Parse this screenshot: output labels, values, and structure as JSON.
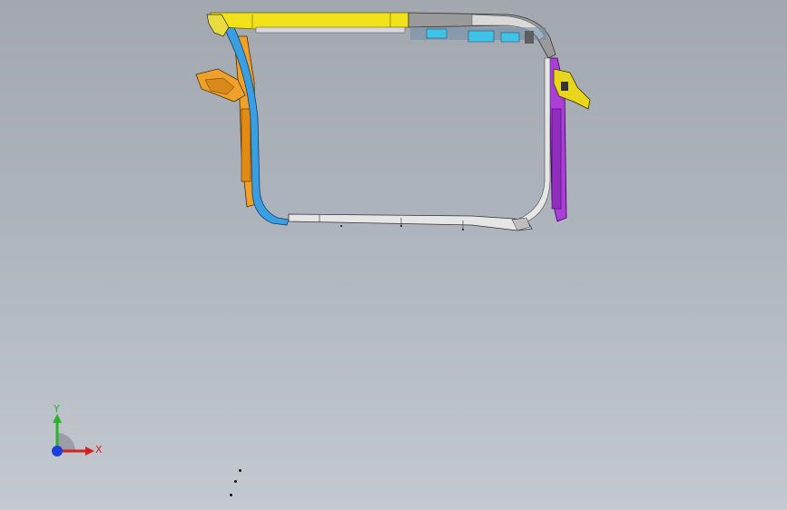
{
  "viewport": {
    "background_top": "#a3a8b0",
    "background_bottom": "#c4c9d0"
  },
  "model": {
    "part_colors": {
      "top_rail": "#f2e21a",
      "top_rail_edge": "#8a7d00",
      "header_grey": "#9a9a9a",
      "header_dark": "#5e5e5e",
      "left_pillar_blue": "#3b9ee0",
      "left_pillar_orange": "#f1a12a",
      "right_pillar_purple": "#a93fd6",
      "right_bracket_yellow": "#e8d61c",
      "bottom_rail": "#e6e6e6",
      "bracket_cyan": "#3fc3e6"
    }
  },
  "triad": {
    "y_label": "Y",
    "x_label": "X",
    "y_color": "#2bb32b",
    "x_color": "#d42020",
    "z_color": "#1f3fd9"
  }
}
